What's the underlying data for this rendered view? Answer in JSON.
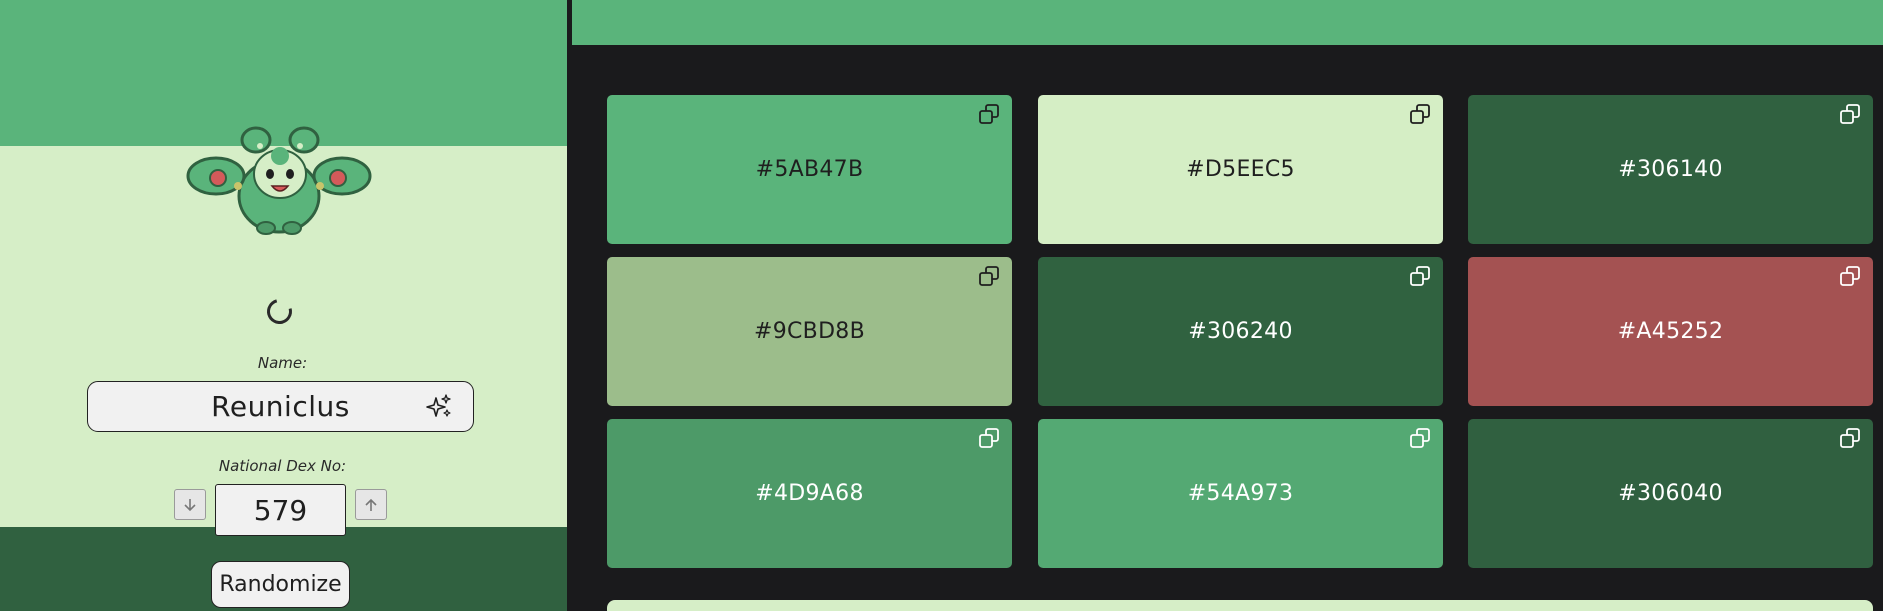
{
  "pokemon": {
    "name_label": "Name:",
    "name": "Reuniclus",
    "dex_label": "National Dex No:",
    "dex_number": "579",
    "randomize_label": "Randomize"
  },
  "palette": [
    {
      "hex": "#5AB47B",
      "text_color": "#1f1f1f"
    },
    {
      "hex": "#D5EEC5",
      "text_color": "#1f1f1f"
    },
    {
      "hex": "#306140",
      "text_color": "#ffffff"
    },
    {
      "hex": "#9CBD8B",
      "text_color": "#1f1f1f"
    },
    {
      "hex": "#306240",
      "text_color": "#ffffff"
    },
    {
      "hex": "#A45252",
      "text_color": "#ffffff"
    },
    {
      "hex": "#4D9A68",
      "text_color": "#ffffff"
    },
    {
      "hex": "#54A973",
      "text_color": "#ffffff"
    },
    {
      "hex": "#306040",
      "text_color": "#ffffff"
    }
  ],
  "icons": {
    "copy": "copy-icon",
    "sparkle": "sparkle-icon",
    "arrow_down": "arrow-down-icon",
    "arrow_up": "arrow-up-icon",
    "spinner": "loading-spinner-icon"
  }
}
